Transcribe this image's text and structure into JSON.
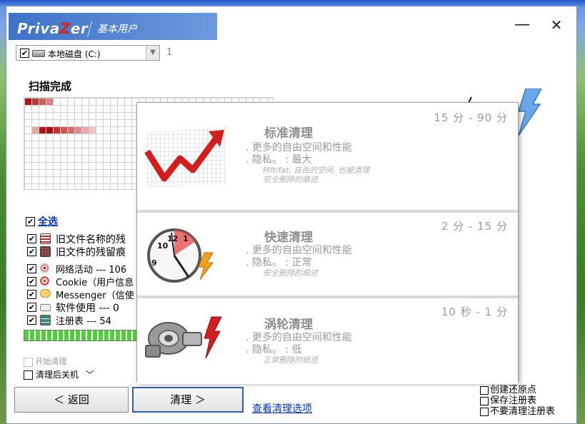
{
  "app": {
    "logo": {
      "pre": "Priva",
      "z": "Z",
      "post": "er"
    },
    "subtitle": "基本用户"
  },
  "window_controls": {
    "minimize": "—",
    "close": "✕"
  },
  "drive": {
    "checked": "✔",
    "label": "本地磁盘 (C:)",
    "count": "1"
  },
  "scan": {
    "title": "扫描完成"
  },
  "selection": {
    "select_all": "全选",
    "items": [
      {
        "label": "旧文件名称的残",
        "checked": "✔",
        "icon": "file-list-icon",
        "big": true
      },
      {
        "label": "旧文件的残留痕",
        "checked": "✔",
        "icon": "grid-icon",
        "big": true
      },
      {
        "label": "网络活动 --- 106",
        "checked": "✔",
        "icon": "target-icon",
        "big": false
      },
      {
        "label": "Cookie（用户信息",
        "checked": "✔",
        "icon": "cookie-icon",
        "big": false
      },
      {
        "label": "Messenger（信使",
        "checked": "✔",
        "icon": "chat-icon",
        "big": false
      },
      {
        "label": "软件使用 ---  0",
        "checked": "✔",
        "icon": "software-icon",
        "big": false
      },
      {
        "label": "注册表 --- 54",
        "checked": "✔",
        "icon": "registry-icon",
        "big": false
      }
    ]
  },
  "progress": {
    "fraction": 1.0
  },
  "after_scan": {
    "start_clean": "开始清理",
    "shutdown": "清理后关机",
    "shutdown_chevron": "﹀"
  },
  "buttons": {
    "back": "＜ 返回",
    "clean": "清理 ＞"
  },
  "link_options": "查看清理选项",
  "right_options": [
    "创建还原点",
    "保存注册表",
    "不要清理注册表"
  ],
  "cleanup_modes": [
    {
      "time": "15 分 - 90 分",
      "title": "标准清理",
      "line1": ". 更多的自由空间和性能",
      "line2": ". 隐私。 : 最大",
      "note1": "Mft/fat, 自由的空间, 也被清理",
      "note2": "安全删除的痕迹",
      "icon": "chart-up-icon"
    },
    {
      "time": "2 分 - 15 分",
      "title": "快速清理",
      "line1": ". 更多的自由空间和性能",
      "line2": ". 隐私。 : 正常",
      "note1": "安全删除的痕迹",
      "icon": "clock-icon"
    },
    {
      "time": "10 秒 - 1 分",
      "title": "涡轮清理",
      "line1": ". 更多的自由空间和性能",
      "line2": ". 隐私。 : 低",
      "note1": "正常删除的痕迹",
      "icon": "turbo-icon"
    }
  ],
  "colors": {
    "accent_blue": "#3d73c8",
    "progress_green": "#4fcf3a",
    "link": "#0033cc",
    "mark_red": "#b01515"
  }
}
